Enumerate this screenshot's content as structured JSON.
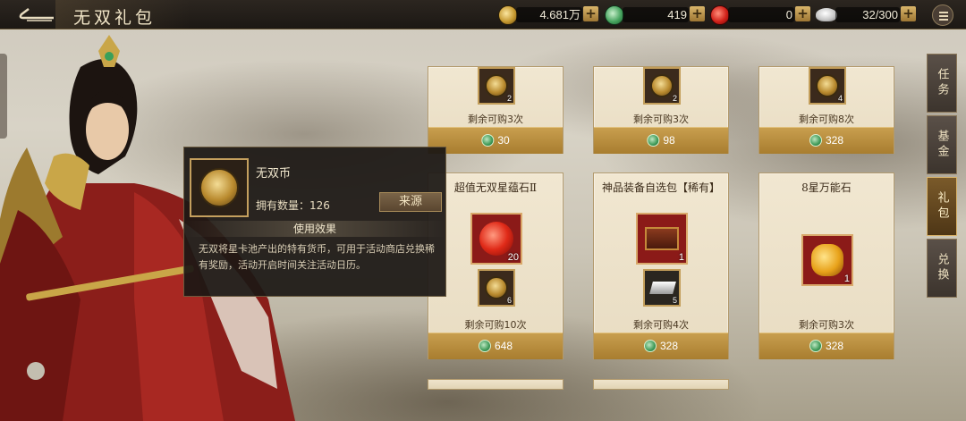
{
  "header": {
    "title": "无双礼包",
    "resources": [
      {
        "icon": "gold-coin-icon",
        "value": "4.681万"
      },
      {
        "icon": "jade-icon",
        "value": "419"
      },
      {
        "icon": "red-gem-icon",
        "value": "0"
      },
      {
        "icon": "silver-ingot-icon",
        "value": "32/300"
      }
    ]
  },
  "tabs": [
    {
      "label": "任务",
      "active": false
    },
    {
      "label": "基金",
      "active": false
    },
    {
      "label": "礼包",
      "active": true
    },
    {
      "label": "兑换",
      "active": false
    }
  ],
  "cards": [
    {
      "title": "",
      "items": [
        {
          "icon": "wushuang-coin-icon",
          "count": "2"
        }
      ],
      "remain": "剩余可购3次",
      "price": "30"
    },
    {
      "title": "",
      "items": [
        {
          "icon": "wushuang-coin-icon",
          "count": "2"
        }
      ],
      "remain": "剩余可购3次",
      "price": "98"
    },
    {
      "title": "",
      "items": [
        {
          "icon": "wushuang-coin-icon",
          "count": "4"
        }
      ],
      "remain": "剩余可购8次",
      "price": "328"
    },
    {
      "title": "超值无双星蕴石Ⅱ",
      "items": [
        {
          "icon": "star-stone-icon",
          "count": "20"
        },
        {
          "icon": "wushuang-coin-icon",
          "count": "6"
        }
      ],
      "remain": "剩余可购10次",
      "price": "648"
    },
    {
      "title": "神品装备自选包【稀有】",
      "items": [
        {
          "icon": "equipment-chest-icon",
          "count": "1"
        },
        {
          "icon": "iron-ingot-icon",
          "count": "5"
        }
      ],
      "remain": "剩余可购4次",
      "price": "328"
    },
    {
      "title": "8星万能石",
      "items": [
        {
          "icon": "universal-stone-icon",
          "count": "1"
        }
      ],
      "remain": "剩余可购3次",
      "price": "328"
    }
  ],
  "tooltip": {
    "name": "无双币",
    "owned_label": "拥有数量：126",
    "source_button": "来源",
    "effect_heading": "使用效果",
    "description": "无双将星卡池产出的特有货币，可用于活动商店兑换稀有奖励，活动开启时间关注活动日历。"
  },
  "colors": {
    "price_bar": "#b48a3a",
    "card_bg": "#efe4cc",
    "tab_active": "#6a4a20"
  }
}
